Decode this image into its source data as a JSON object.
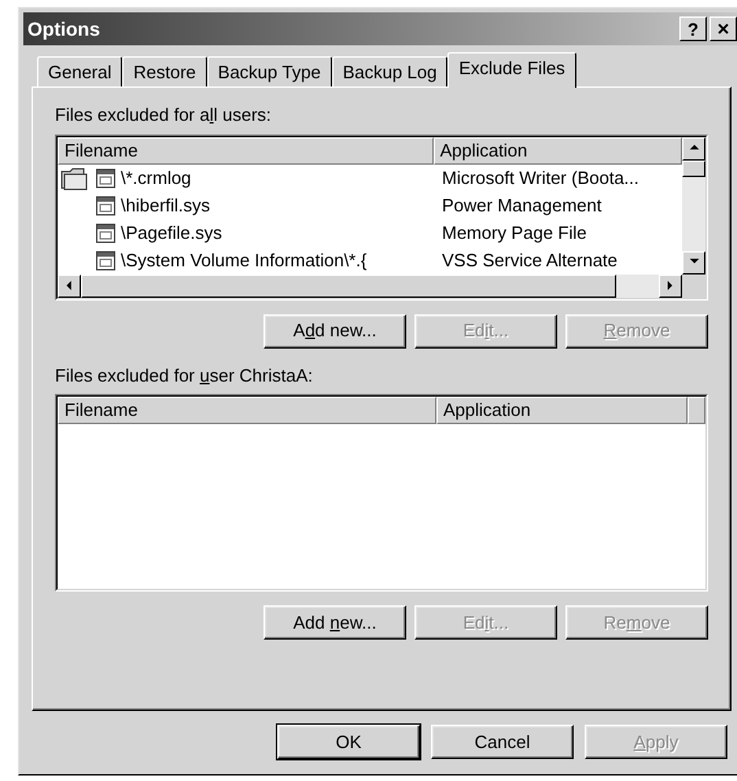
{
  "window": {
    "title": "Options",
    "help": "?",
    "close": "×"
  },
  "tabs": [
    {
      "label": "General",
      "selected": false
    },
    {
      "label": "Restore",
      "selected": false
    },
    {
      "label": "Backup Type",
      "selected": false
    },
    {
      "label": "Backup Log",
      "selected": false
    },
    {
      "label": "Exclude Files",
      "selected": true
    }
  ],
  "all_users": {
    "label": {
      "pre": "Files excluded for a",
      "key": "l",
      "post": "l users:"
    },
    "columns": [
      "Filename",
      "Application"
    ],
    "rows": [
      {
        "folder": true,
        "filename": "\\*.crmlog",
        "application": "Microsoft Writer (Boota..."
      },
      {
        "folder": false,
        "filename": "\\hiberfil.sys",
        "application": "Power Management"
      },
      {
        "folder": false,
        "filename": "\\Pagefile.sys",
        "application": "Memory Page File"
      },
      {
        "folder": false,
        "filename": "\\System Volume Information\\*.{",
        "application": "VSS Service Alternate"
      }
    ],
    "buttons": [
      {
        "label": {
          "pre": "A",
          "key": "d",
          "post": "d new..."
        },
        "disabled": false
      },
      {
        "label": {
          "pre": "Ed",
          "key": "i",
          "post": "t..."
        },
        "disabled": true
      },
      {
        "label": {
          "key": "R",
          "post": "emove"
        },
        "disabled": true
      }
    ]
  },
  "user": {
    "label": {
      "pre": "Files excluded for ",
      "key": "u",
      "post": "ser ChristaA:"
    },
    "columns": [
      "Filename",
      "Application"
    ],
    "buttons": [
      {
        "label": {
          "pre": "Add ",
          "key": "n",
          "post": "ew..."
        },
        "disabled": false
      },
      {
        "label": {
          "pre": "Ed",
          "key": "i",
          "post": "t..."
        },
        "disabled": true
      },
      {
        "label": {
          "pre": "Re",
          "key": "m",
          "post": "ove"
        },
        "disabled": true
      }
    ]
  },
  "buttons": [
    {
      "label": {
        "pre": "OK"
      },
      "disabled": false,
      "default": true
    },
    {
      "label": {
        "pre": "Cancel"
      },
      "disabled": false,
      "default": false
    },
    {
      "label": {
        "key": "A",
        "post": "pply"
      },
      "disabled": true,
      "default": false
    }
  ]
}
